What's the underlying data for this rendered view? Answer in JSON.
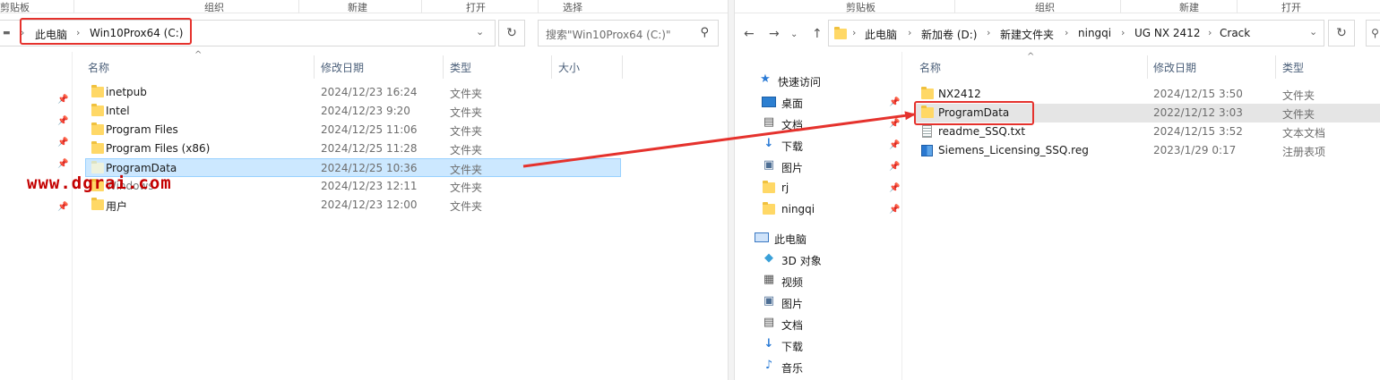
{
  "left": {
    "ribbon": [
      "剪贴板",
      "组织",
      "新建",
      "打开",
      "选择"
    ],
    "breadcrumb": [
      "此电脑",
      "Win10Prox64 (C:)"
    ],
    "search_placeholder": "搜索\"Win10Prox64 (C:)\"",
    "columns": [
      "名称",
      "修改日期",
      "类型",
      "大小"
    ],
    "files": [
      {
        "name": "inetpub",
        "date": "2024/12/23 16:24",
        "type": "文件夹"
      },
      {
        "name": "Intel",
        "date": "2024/12/23 9:20",
        "type": "文件夹"
      },
      {
        "name": "Program Files",
        "date": "2024/12/25 11:06",
        "type": "文件夹"
      },
      {
        "name": "Program Files (x86)",
        "date": "2024/12/25 11:28",
        "type": "文件夹"
      },
      {
        "name": "ProgramData",
        "date": "2024/12/25 10:36",
        "type": "文件夹"
      },
      {
        "name": "Windows",
        "date": "2024/12/23 12:11",
        "type": "文件夹"
      },
      {
        "name": "用户",
        "date": "2024/12/23 12:00",
        "type": "文件夹"
      }
    ]
  },
  "watermark": "www.dgrai.com",
  "right": {
    "ribbon": [
      "剪贴板",
      "组织",
      "新建",
      "打开"
    ],
    "breadcrumb": [
      "此电脑",
      "新加卷 (D:)",
      "新建文件夹",
      "ningqi",
      "UG NX 2412",
      "Crack"
    ],
    "columns": [
      "名称",
      "修改日期",
      "类型"
    ],
    "nav": {
      "quick_access": "快速访问",
      "quick_items": [
        "桌面",
        "文档",
        "下载",
        "图片",
        "rj",
        "ningqi"
      ],
      "this_pc": "此电脑",
      "pc_items": [
        "3D 对象",
        "视频",
        "图片",
        "文档",
        "下载",
        "音乐"
      ]
    },
    "files": [
      {
        "name": "NX2412",
        "date": "2024/12/15 3:50",
        "type": "文件夹",
        "icon": "folder-icon"
      },
      {
        "name": "ProgramData",
        "date": "2022/12/12 3:03",
        "type": "文件夹",
        "icon": "folder-icon"
      },
      {
        "name": "readme_SSQ.txt",
        "date": "2024/12/15 3:52",
        "type": "文本文档",
        "icon": "text-file-icon"
      },
      {
        "name": "Siemens_Licensing_SSQ.reg",
        "date": "2023/1/29 0:17",
        "type": "注册表项",
        "icon": "registry-file-icon"
      }
    ]
  },
  "colors": {
    "annotation_red": "#e5322d",
    "selection": "#cce8ff",
    "watermark": "#c40000"
  }
}
